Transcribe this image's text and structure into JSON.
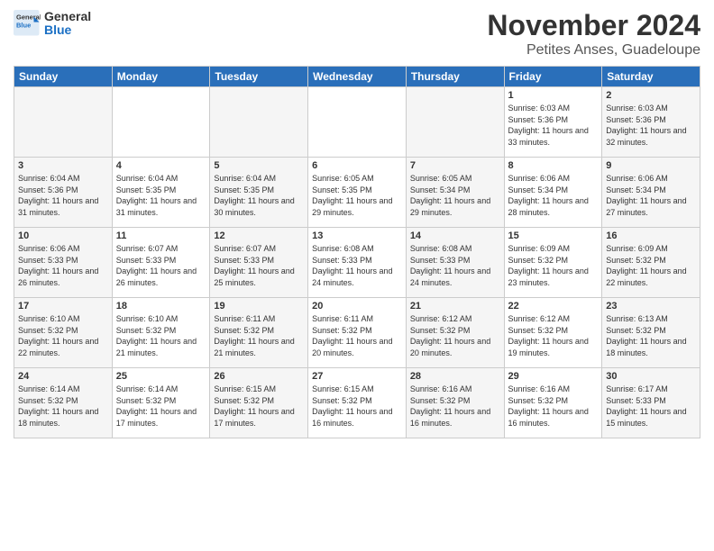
{
  "logo": {
    "general": "General",
    "blue": "Blue"
  },
  "title": "November 2024",
  "location": "Petites Anses, Guadeloupe",
  "days_of_week": [
    "Sunday",
    "Monday",
    "Tuesday",
    "Wednesday",
    "Thursday",
    "Friday",
    "Saturday"
  ],
  "weeks": [
    [
      {
        "day": "",
        "info": ""
      },
      {
        "day": "",
        "info": ""
      },
      {
        "day": "",
        "info": ""
      },
      {
        "day": "",
        "info": ""
      },
      {
        "day": "",
        "info": ""
      },
      {
        "day": "1",
        "info": "Sunrise: 6:03 AM\nSunset: 5:36 PM\nDaylight: 11 hours and 33 minutes."
      },
      {
        "day": "2",
        "info": "Sunrise: 6:03 AM\nSunset: 5:36 PM\nDaylight: 11 hours and 32 minutes."
      }
    ],
    [
      {
        "day": "3",
        "info": "Sunrise: 6:04 AM\nSunset: 5:36 PM\nDaylight: 11 hours and 31 minutes."
      },
      {
        "day": "4",
        "info": "Sunrise: 6:04 AM\nSunset: 5:35 PM\nDaylight: 11 hours and 31 minutes."
      },
      {
        "day": "5",
        "info": "Sunrise: 6:04 AM\nSunset: 5:35 PM\nDaylight: 11 hours and 30 minutes."
      },
      {
        "day": "6",
        "info": "Sunrise: 6:05 AM\nSunset: 5:35 PM\nDaylight: 11 hours and 29 minutes."
      },
      {
        "day": "7",
        "info": "Sunrise: 6:05 AM\nSunset: 5:34 PM\nDaylight: 11 hours and 29 minutes."
      },
      {
        "day": "8",
        "info": "Sunrise: 6:06 AM\nSunset: 5:34 PM\nDaylight: 11 hours and 28 minutes."
      },
      {
        "day": "9",
        "info": "Sunrise: 6:06 AM\nSunset: 5:34 PM\nDaylight: 11 hours and 27 minutes."
      }
    ],
    [
      {
        "day": "10",
        "info": "Sunrise: 6:06 AM\nSunset: 5:33 PM\nDaylight: 11 hours and 26 minutes."
      },
      {
        "day": "11",
        "info": "Sunrise: 6:07 AM\nSunset: 5:33 PM\nDaylight: 11 hours and 26 minutes."
      },
      {
        "day": "12",
        "info": "Sunrise: 6:07 AM\nSunset: 5:33 PM\nDaylight: 11 hours and 25 minutes."
      },
      {
        "day": "13",
        "info": "Sunrise: 6:08 AM\nSunset: 5:33 PM\nDaylight: 11 hours and 24 minutes."
      },
      {
        "day": "14",
        "info": "Sunrise: 6:08 AM\nSunset: 5:33 PM\nDaylight: 11 hours and 24 minutes."
      },
      {
        "day": "15",
        "info": "Sunrise: 6:09 AM\nSunset: 5:32 PM\nDaylight: 11 hours and 23 minutes."
      },
      {
        "day": "16",
        "info": "Sunrise: 6:09 AM\nSunset: 5:32 PM\nDaylight: 11 hours and 22 minutes."
      }
    ],
    [
      {
        "day": "17",
        "info": "Sunrise: 6:10 AM\nSunset: 5:32 PM\nDaylight: 11 hours and 22 minutes."
      },
      {
        "day": "18",
        "info": "Sunrise: 6:10 AM\nSunset: 5:32 PM\nDaylight: 11 hours and 21 minutes."
      },
      {
        "day": "19",
        "info": "Sunrise: 6:11 AM\nSunset: 5:32 PM\nDaylight: 11 hours and 21 minutes."
      },
      {
        "day": "20",
        "info": "Sunrise: 6:11 AM\nSunset: 5:32 PM\nDaylight: 11 hours and 20 minutes."
      },
      {
        "day": "21",
        "info": "Sunrise: 6:12 AM\nSunset: 5:32 PM\nDaylight: 11 hours and 20 minutes."
      },
      {
        "day": "22",
        "info": "Sunrise: 6:12 AM\nSunset: 5:32 PM\nDaylight: 11 hours and 19 minutes."
      },
      {
        "day": "23",
        "info": "Sunrise: 6:13 AM\nSunset: 5:32 PM\nDaylight: 11 hours and 18 minutes."
      }
    ],
    [
      {
        "day": "24",
        "info": "Sunrise: 6:14 AM\nSunset: 5:32 PM\nDaylight: 11 hours and 18 minutes."
      },
      {
        "day": "25",
        "info": "Sunrise: 6:14 AM\nSunset: 5:32 PM\nDaylight: 11 hours and 17 minutes."
      },
      {
        "day": "26",
        "info": "Sunrise: 6:15 AM\nSunset: 5:32 PM\nDaylight: 11 hours and 17 minutes."
      },
      {
        "day": "27",
        "info": "Sunrise: 6:15 AM\nSunset: 5:32 PM\nDaylight: 11 hours and 16 minutes."
      },
      {
        "day": "28",
        "info": "Sunrise: 6:16 AM\nSunset: 5:32 PM\nDaylight: 11 hours and 16 minutes."
      },
      {
        "day": "29",
        "info": "Sunrise: 6:16 AM\nSunset: 5:32 PM\nDaylight: 11 hours and 16 minutes."
      },
      {
        "day": "30",
        "info": "Sunrise: 6:17 AM\nSunset: 5:33 PM\nDaylight: 11 hours and 15 minutes."
      }
    ]
  ]
}
